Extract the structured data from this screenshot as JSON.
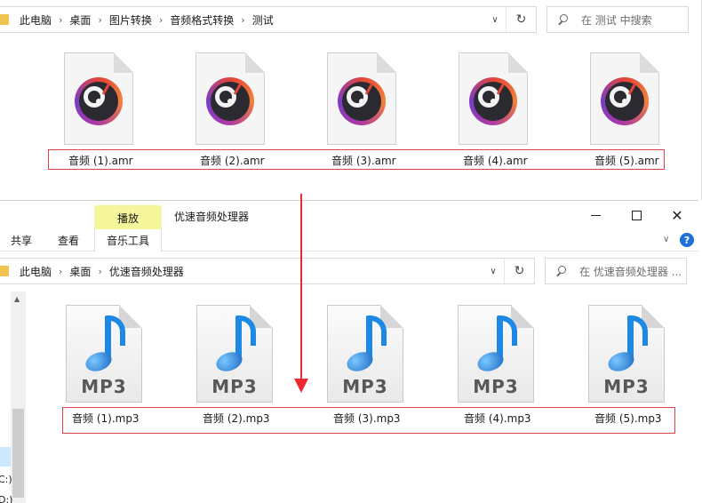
{
  "window_top": {
    "breadcrumb": [
      "此电脑",
      "桌面",
      "图片转换",
      "音频格式转换",
      "测试"
    ],
    "search_placeholder": "在 测试 中搜索",
    "files": [
      {
        "name": "音频 (1).amr",
        "icon": "amr-audio-file-icon"
      },
      {
        "name": "音频 (2).amr",
        "icon": "amr-audio-file-icon"
      },
      {
        "name": "音频 (3).amr",
        "icon": "amr-audio-file-icon"
      },
      {
        "name": "音频 (4).amr",
        "icon": "amr-audio-file-icon"
      },
      {
        "name": "音频 (5).amr",
        "icon": "amr-audio-file-icon"
      }
    ]
  },
  "window_bottom": {
    "context_tab": "播放",
    "title": "优速音频处理器",
    "ribbon_tabs": [
      "共享",
      "查看",
      "音乐工具"
    ],
    "help_glyph": "?",
    "breadcrumb": [
      "此电脑",
      "桌面",
      "优速音频处理器"
    ],
    "search_placeholder": "在 优速音频处理器 ...",
    "nav_pane_items": [
      "C:)",
      "D:)"
    ],
    "file_type_label": "MP3",
    "files": [
      {
        "name": "音频 (1).mp3",
        "icon": "mp3-file-icon"
      },
      {
        "name": "音频 (2).mp3",
        "icon": "mp3-file-icon"
      },
      {
        "name": "音频 (3).mp3",
        "icon": "mp3-file-icon"
      },
      {
        "name": "音频 (4).mp3",
        "icon": "mp3-file-icon"
      },
      {
        "name": "音频 (5).mp3",
        "icon": "mp3-file-icon"
      }
    ]
  },
  "colors": {
    "annotation_red": "#e0414b",
    "arrow_red": "#ef2a2f",
    "context_tab_yellow": "#f5f59b",
    "folder_yellow": "#f0c24f",
    "help_blue": "#1e6fd9"
  }
}
